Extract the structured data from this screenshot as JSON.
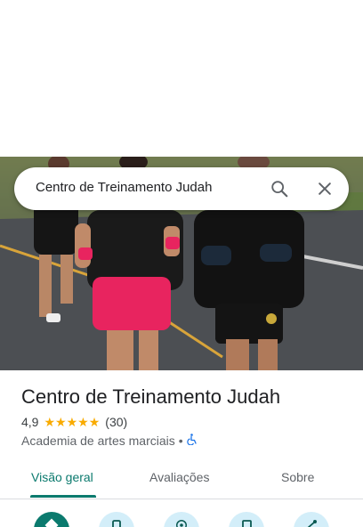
{
  "search": {
    "query": "Centro de Treinamento Judah"
  },
  "place": {
    "name": "Centro de Treinamento Judah",
    "rating": "4,9",
    "stars": 5,
    "review_count": "(30)",
    "category": "Academia de artes marciais",
    "separator": "•"
  },
  "tabs": [
    {
      "label": "Visão geral",
      "active": true
    },
    {
      "label": "Avaliações",
      "active": false
    },
    {
      "label": "Sobre",
      "active": false
    }
  ],
  "actions": [
    {
      "icon": "directions-icon"
    },
    {
      "icon": "phone-icon"
    },
    {
      "icon": "start-navigation-icon"
    },
    {
      "icon": "save-bookmark-icon"
    },
    {
      "icon": "share-icon"
    }
  ],
  "colors": {
    "accent": "#0b7a6e",
    "star": "#f9ab00",
    "action_bg": "#d3eef9"
  }
}
